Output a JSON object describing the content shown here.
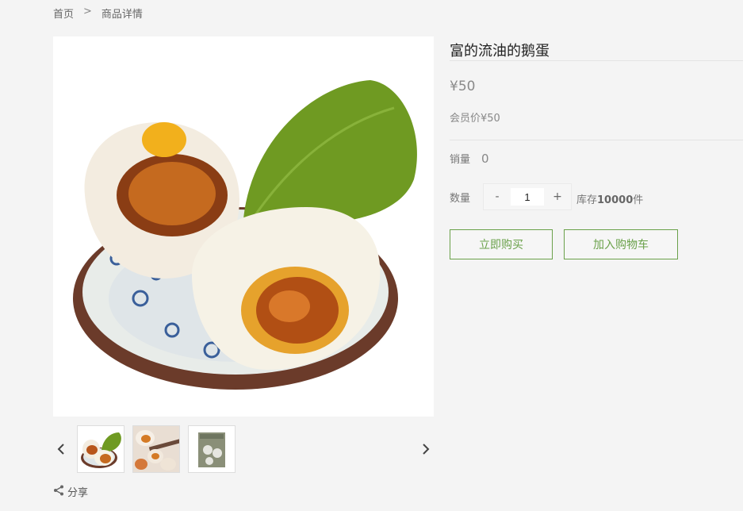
{
  "breadcrumb": {
    "home": "首页",
    "sep": ">",
    "current": "商品详情"
  },
  "product": {
    "title": "富的流油的鹅蛋",
    "price": "¥50",
    "member_price": "会员价¥50",
    "sales_label": "销量",
    "sales_value": "0",
    "qty_label": "数量",
    "qty_minus": "-",
    "qty_value": "1",
    "qty_plus": "+",
    "stock_prefix": "库存",
    "stock_value": "10000",
    "stock_suffix": "件",
    "buy_now": "立即购买",
    "add_to_cart": "加入购物车"
  },
  "share": {
    "label": "分享"
  },
  "colors": {
    "accent": "#6aa14a",
    "background": "#f4f4f4"
  }
}
